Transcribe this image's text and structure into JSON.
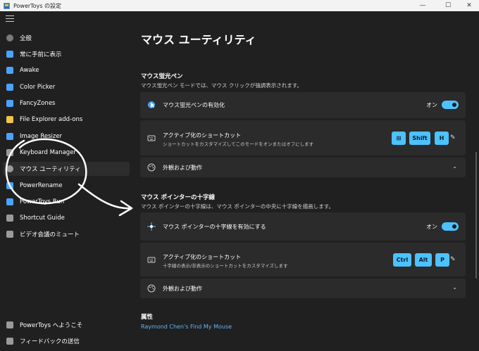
{
  "window": {
    "title": "PowerToys の設定",
    "controls": [
      "—",
      "☐",
      "✕"
    ]
  },
  "sidebar": {
    "items": [
      {
        "label": "全般",
        "icon": "gear-icon",
        "color": "#7a7a7a"
      },
      {
        "label": "常に手前に表示",
        "icon": "pin-window-icon",
        "color": "#4aa3ff"
      },
      {
        "label": "Awake",
        "icon": "coffee-icon",
        "color": "#4aa3ff"
      },
      {
        "label": "Color Picker",
        "icon": "eyedropper-icon",
        "color": "#4aa3ff"
      },
      {
        "label": "FancyZones",
        "icon": "zones-icon",
        "color": "#4aa3ff"
      },
      {
        "label": "File Explorer add-ons",
        "icon": "folder-icon",
        "color": "#f2c14e"
      },
      {
        "label": "Image Resizer",
        "icon": "image-icon",
        "color": "#4aa3ff"
      },
      {
        "label": "Keyboard Manager",
        "icon": "keyboard-icon",
        "color": "#9a9a9a"
      },
      {
        "label": "マウス ユーティリティ",
        "icon": "mouse-icon",
        "color": "#9a9a9a",
        "active": true
      },
      {
        "label": "PowerRename",
        "icon": "rename-icon",
        "color": "#4aa3ff"
      },
      {
        "label": "PowerToys Run",
        "icon": "run-icon",
        "color": "#4aa3ff"
      },
      {
        "label": "Shortcut Guide",
        "icon": "shortcut-guide-icon",
        "color": "#9a9a9a"
      },
      {
        "label": "ビデオ会議のミュート",
        "icon": "video-mute-icon",
        "color": "#9a9a9a"
      }
    ],
    "footer": [
      {
        "label": "PowerToys へようこそ",
        "icon": "welcome-icon"
      },
      {
        "label": "フィードバックの送信",
        "icon": "feedback-icon"
      }
    ]
  },
  "main": {
    "title": "マウス ユーティリティ",
    "highlighter": {
      "title": "マウス蛍光ペン",
      "description": "マウス蛍光ペン モードでは、マウス クリックが強調表示されます。",
      "enable_label": "マウス蛍光ペンの有効化",
      "toggle_text": "オン",
      "shortcut_label": "アクティブ化のショートカット",
      "shortcut_desc": "ショートカットをカスタマイズしてこのモードをオンまたはオフにします",
      "keys": [
        "⊞",
        "Shift",
        "H"
      ],
      "appearance_label": "外観および動作"
    },
    "crosshairs": {
      "title": "マウス ポインターの十字線",
      "description": "マウス ポインターの十字線は、マウス ポインターの中央に十字線を描画します。",
      "enable_label": "マウス ポインターの十字線を有効にする",
      "toggle_text": "オン",
      "shortcut_label": "アクティブ化のショートカット",
      "shortcut_desc": "十字線の表示/非表示のショートカットをカスタマイズします",
      "keys": [
        "Ctrl",
        "Alt",
        "P"
      ],
      "appearance_label": "外観および動作"
    },
    "attribution": {
      "title": "属性",
      "link": "Raymond Chen's Find My Mouse"
    }
  },
  "colors": {
    "accent": "#4cc2ff",
    "background": "#202020",
    "card": "#2b2b2b",
    "link": "#5fb7f5"
  }
}
